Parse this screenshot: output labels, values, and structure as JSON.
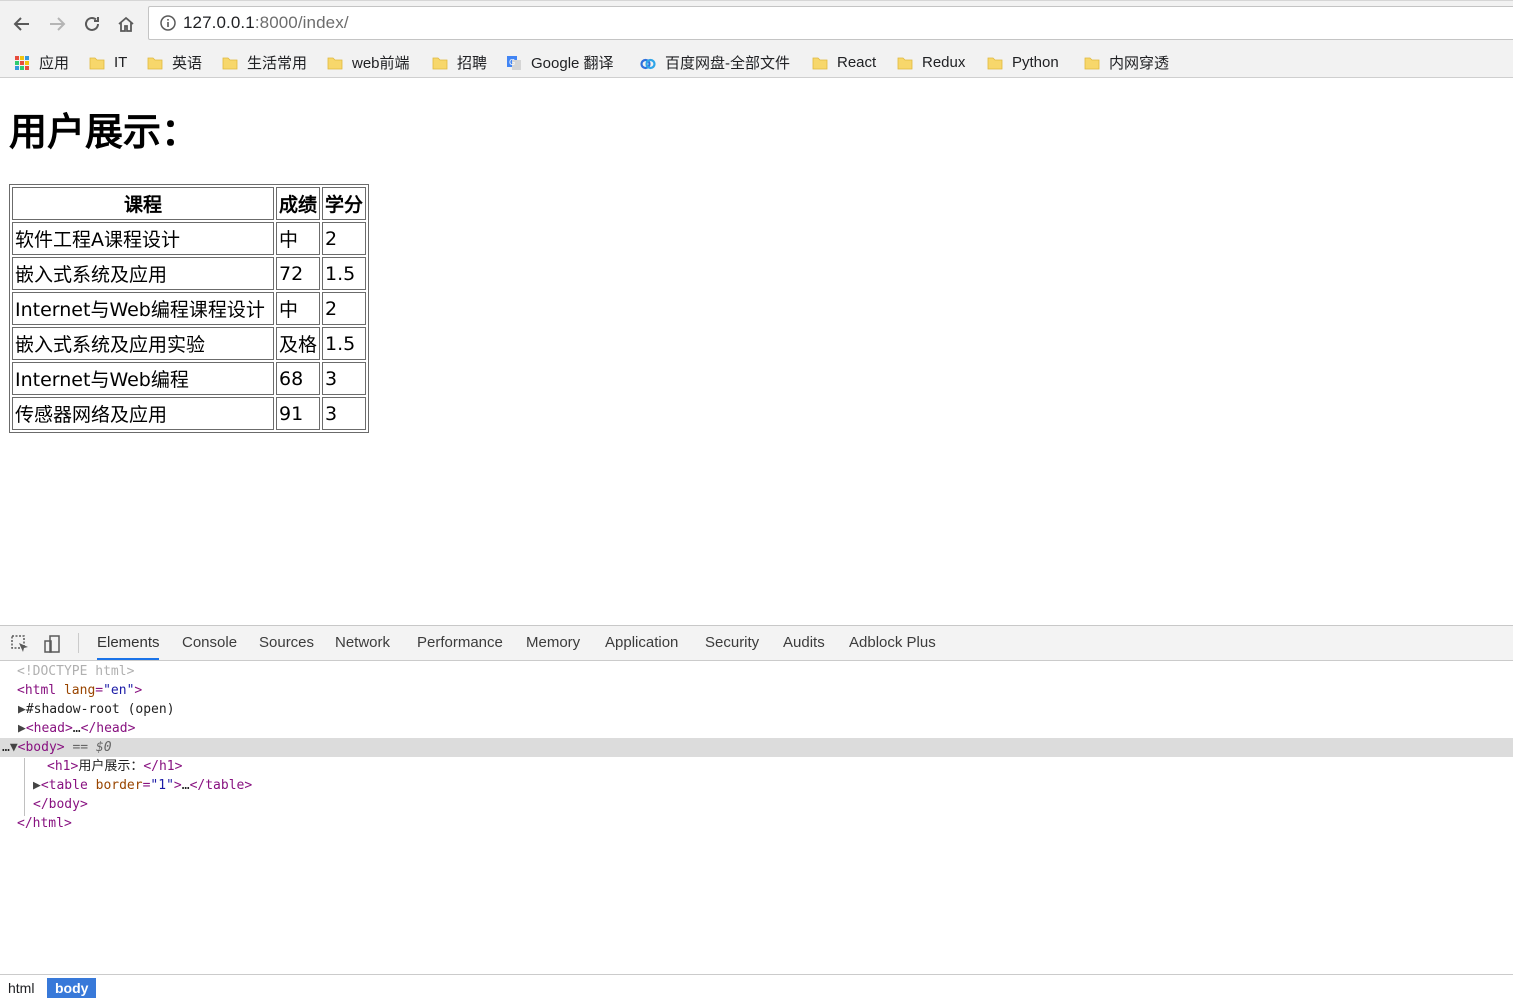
{
  "browser": {
    "url_host": "127.0.0.1",
    "url_rest": ":8000/index/",
    "bookmarks": [
      {
        "label": "应用",
        "icon": "apps-grid-icon"
      },
      {
        "label": "IT",
        "icon": "folder-icon"
      },
      {
        "label": "英语",
        "icon": "folder-icon"
      },
      {
        "label": "生活常用",
        "icon": "folder-icon"
      },
      {
        "label": "web前端",
        "icon": "folder-icon"
      },
      {
        "label": "招聘",
        "icon": "folder-icon"
      },
      {
        "label": "Google 翻译",
        "icon": "google-translate-icon"
      },
      {
        "label": "百度网盘-全部文件",
        "icon": "baidu-netdisk-icon"
      },
      {
        "label": "React",
        "icon": "folder-icon"
      },
      {
        "label": "Redux",
        "icon": "folder-icon"
      },
      {
        "label": "Python",
        "icon": "folder-icon"
      },
      {
        "label": "内网穿透",
        "icon": "folder-icon"
      }
    ]
  },
  "page": {
    "heading": "用户展示：",
    "table": {
      "headers": [
        "课程",
        "成绩",
        "学分"
      ],
      "rows": [
        [
          "软件工程A课程设计",
          "中",
          "2"
        ],
        [
          "嵌入式系统及应用",
          "72",
          "1.5"
        ],
        [
          "Internet与Web编程课程设计",
          "中",
          "2"
        ],
        [
          "嵌入式系统及应用实验",
          "及格",
          "1.5"
        ],
        [
          "Internet与Web编程",
          "68",
          "3"
        ],
        [
          "传感器网络及应用",
          "91",
          "3"
        ]
      ]
    }
  },
  "devtools": {
    "tabs": [
      "Elements",
      "Console",
      "Sources",
      "Network",
      "Performance",
      "Memory",
      "Application",
      "Security",
      "Audits",
      "Adblock Plus"
    ],
    "active_tab": "Elements",
    "dom": {
      "doctype": "<!DOCTYPE html>",
      "html_open_tag": "html",
      "html_attr": "lang",
      "html_attr_val": "\"en\"",
      "shadow_root": "#shadow-root (open)",
      "head_tag": "head",
      "body_tag": "body",
      "selected_marker": "== $0",
      "h1_tag": "h1",
      "h1_text": "用户展示：",
      "table_tag": "table",
      "table_attr": "border",
      "table_attr_val": "\"1\"",
      "ellipsis": "…"
    },
    "breadcrumbs": [
      "html",
      "body"
    ]
  },
  "colors": {
    "accent": "#1a73e8",
    "crumb_active": "#3879d9",
    "folder": "#f7d76b"
  }
}
